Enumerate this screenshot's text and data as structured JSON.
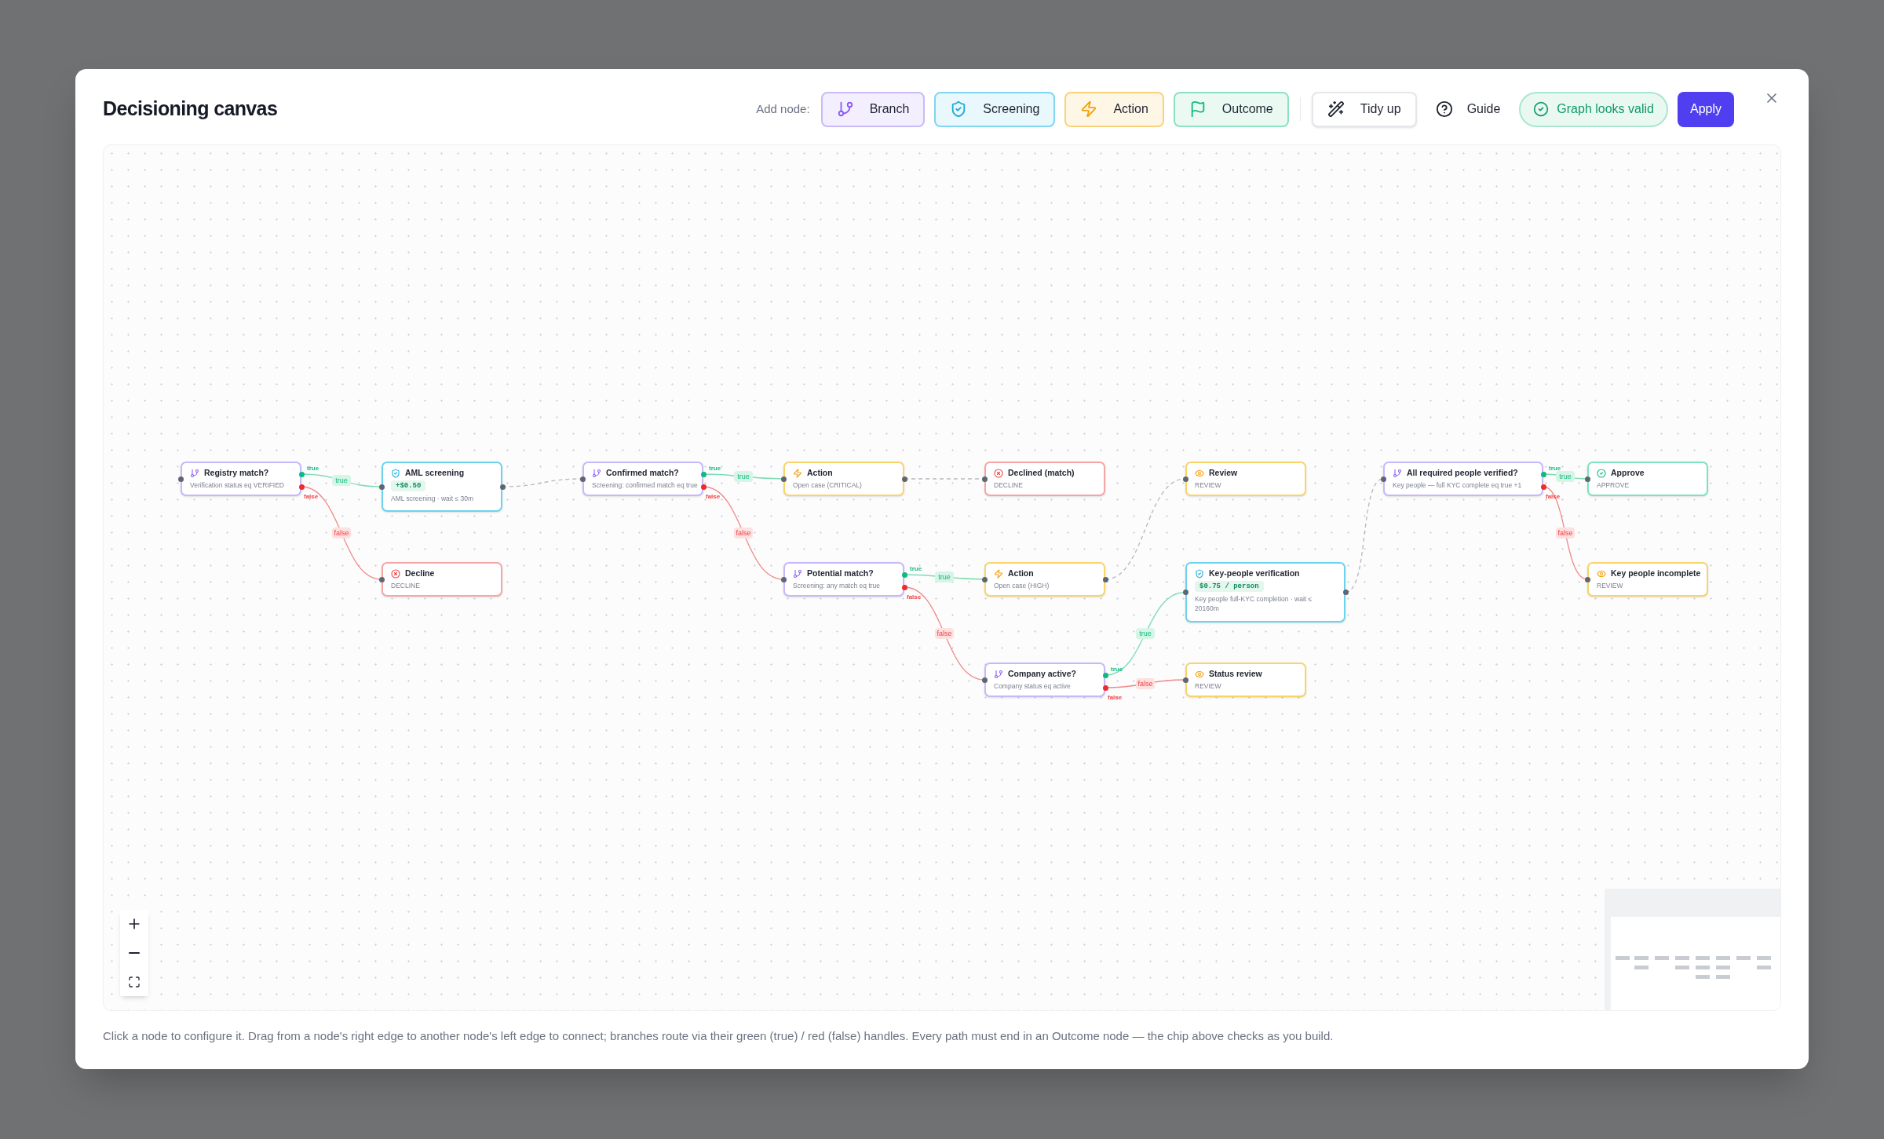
{
  "window": {
    "title": "Decisioning canvas"
  },
  "toolbar": {
    "add_node_label": "Add node:",
    "add_buttons": [
      {
        "label": "Branch",
        "kind": "branch"
      },
      {
        "label": "Screening",
        "kind": "screening"
      },
      {
        "label": "Action",
        "kind": "action"
      },
      {
        "label": "Outcome",
        "kind": "outcome"
      }
    ],
    "tidy_button": "Tidy up",
    "guide_button": "Guide",
    "status_chip": "Graph looks valid",
    "apply_button": "Apply"
  },
  "canvas": {
    "nodes": [
      {
        "kind": "branch",
        "title": "Registry match?",
        "subtitle": "Verification status eq VERIFIED"
      },
      {
        "kind": "screening",
        "title": "AML screening",
        "price": "+$0.50",
        "subtitle": "AML screening · wait ≤ 30m"
      },
      {
        "kind": "decline",
        "title": "Decline",
        "subtitle": "DECLINE"
      },
      {
        "kind": "branch",
        "title": "Confirmed match?",
        "subtitle": "Screening: confirmed match eq true"
      },
      {
        "kind": "action",
        "title": "Action",
        "subtitle": "Open case (CRITICAL)"
      },
      {
        "kind": "branch",
        "title": "Potential match?",
        "subtitle": "Screening: any match eq true"
      },
      {
        "kind": "decline",
        "title": "Declined (match)",
        "subtitle": "DECLINE"
      },
      {
        "kind": "action",
        "title": "Action",
        "subtitle": "Open case (HIGH)"
      },
      {
        "kind": "branch",
        "title": "Company active?",
        "subtitle": "Company status eq active"
      },
      {
        "kind": "review",
        "title": "Review",
        "subtitle": "REVIEW"
      },
      {
        "kind": "screening",
        "title": "Key-people verification",
        "price": "$0.75 / person",
        "subtitle": "Key people full-KYC completion · wait ≤ 20160m"
      },
      {
        "kind": "review",
        "title": "Status review",
        "subtitle": "REVIEW"
      },
      {
        "kind": "branch",
        "title": "All required people verified?",
        "subtitle": "Key people — full KYC complete eq true +1"
      },
      {
        "kind": "approve",
        "title": "Approve",
        "subtitle": "APPROVE"
      },
      {
        "kind": "review",
        "title": "Key people incomplete",
        "subtitle": "REVIEW"
      }
    ],
    "edges": [
      {
        "kind": "true",
        "handle_label": "true",
        "label": "true"
      },
      {
        "kind": "false",
        "handle_label": "false",
        "label": "false"
      },
      {
        "kind": "plain"
      },
      {
        "kind": "true",
        "handle_label": "true",
        "label": "true"
      },
      {
        "kind": "false",
        "handle_label": "false",
        "label": "false"
      },
      {
        "kind": "plain"
      },
      {
        "kind": "true",
        "handle_label": "true",
        "label": "true"
      },
      {
        "kind": "false",
        "handle_label": "false",
        "label": "false"
      },
      {
        "kind": "plain"
      },
      {
        "kind": "true",
        "handle_label": "true",
        "label": "true"
      },
      {
        "kind": "false",
        "handle_label": "false",
        "label": "false"
      },
      {
        "kind": "plain"
      },
      {
        "kind": "true",
        "handle_label": "true",
        "label": "true"
      },
      {
        "kind": "false",
        "handle_label": "false",
        "label": "false"
      }
    ]
  },
  "footer_hint": "Click a node to configure it. Drag from a node's right edge to another node's left edge to connect; branches route via their green (true) / red (false) handles. Every path must end in an Outcome node — the chip above checks as you build."
}
